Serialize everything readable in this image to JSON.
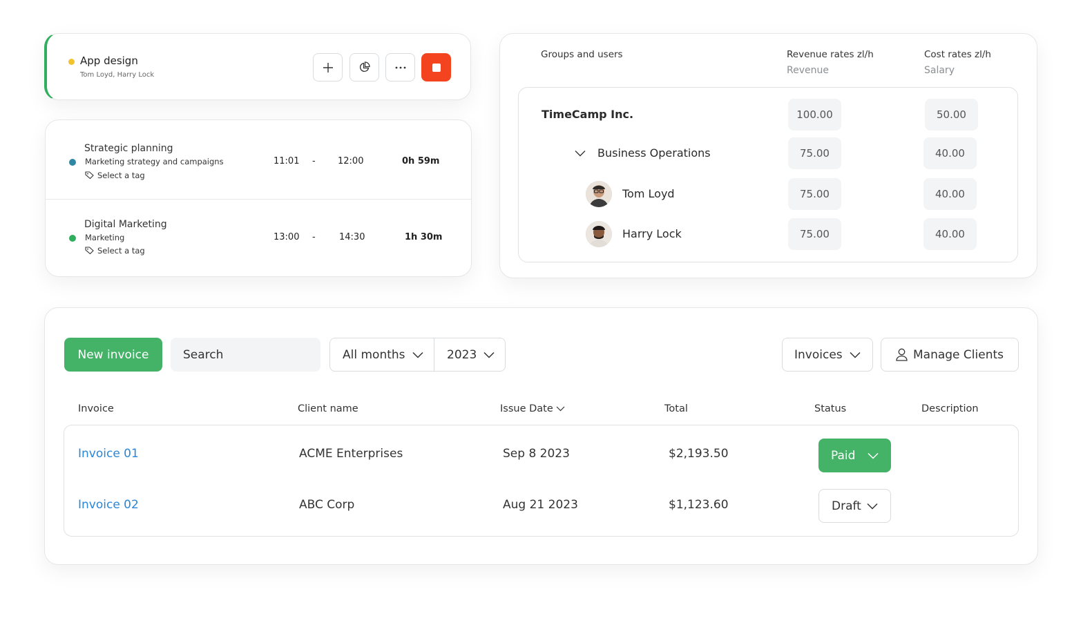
{
  "timer": {
    "title": "App design",
    "assignees": "Tom Loyd, Harry Lock",
    "icons": [
      "plus-icon",
      "pie-chart-icon",
      "more-icon",
      "stop-icon"
    ],
    "dot_color": "#f2c230",
    "accent_color": "#2fae5e",
    "stop_color": "#f3441f"
  },
  "entries": [
    {
      "title": "Strategic planning",
      "subtitle": "Marketing strategy and campaigns",
      "tag": "Select a tag",
      "start": "11:01",
      "separator": "-",
      "end": "12:00",
      "duration": "0h 59m",
      "dot_color": "#2f87a3"
    },
    {
      "title": "Digital Marketing",
      "subtitle": "Marketing",
      "tag": "Select a tag",
      "start": "13:00",
      "separator": "-",
      "end": "14:30",
      "duration": "1h 30m",
      "dot_color": "#2fae5e"
    }
  ],
  "rates": {
    "header_groups": "Groups and users",
    "header_revenue": "Revenue rates zl/h",
    "header_revenue_sub": "Revenue",
    "header_cost": "Cost rates zl/h",
    "header_cost_sub": "Salary",
    "rows": [
      {
        "name": "TimeCamp Inc.",
        "revenue": "100.00",
        "cost": "50.00"
      },
      {
        "name": "Business Operations",
        "revenue": "75.00",
        "cost": "40.00"
      },
      {
        "name": "Tom Loyd",
        "revenue": "75.00",
        "cost": "40.00"
      },
      {
        "name": "Harry Lock",
        "revenue": "75.00",
        "cost": "40.00"
      }
    ]
  },
  "invoices": {
    "new_invoice_label": "New invoice",
    "search_placeholder": "Search",
    "months_value": "All months",
    "year_value": "2023",
    "type_value": "Invoices",
    "manage_clients_label": "Manage Clients",
    "columns": {
      "invoice": "Invoice",
      "client": "Client name",
      "issue_date": "Issue Date",
      "total": "Total",
      "status": "Status",
      "description": "Description"
    },
    "rows": [
      {
        "invoice": "Invoice 01",
        "client": "ACME Enterprises",
        "date": "Sep 8 2023",
        "total": "$2,193.50",
        "status": "Paid"
      },
      {
        "invoice": "Invoice 02",
        "client": "ABC Corp",
        "date": "Aug 21 2023",
        "total": "$1,123.60",
        "status": "Draft"
      }
    ],
    "brand_green": "#44b267",
    "link_blue": "#2a86d6"
  }
}
